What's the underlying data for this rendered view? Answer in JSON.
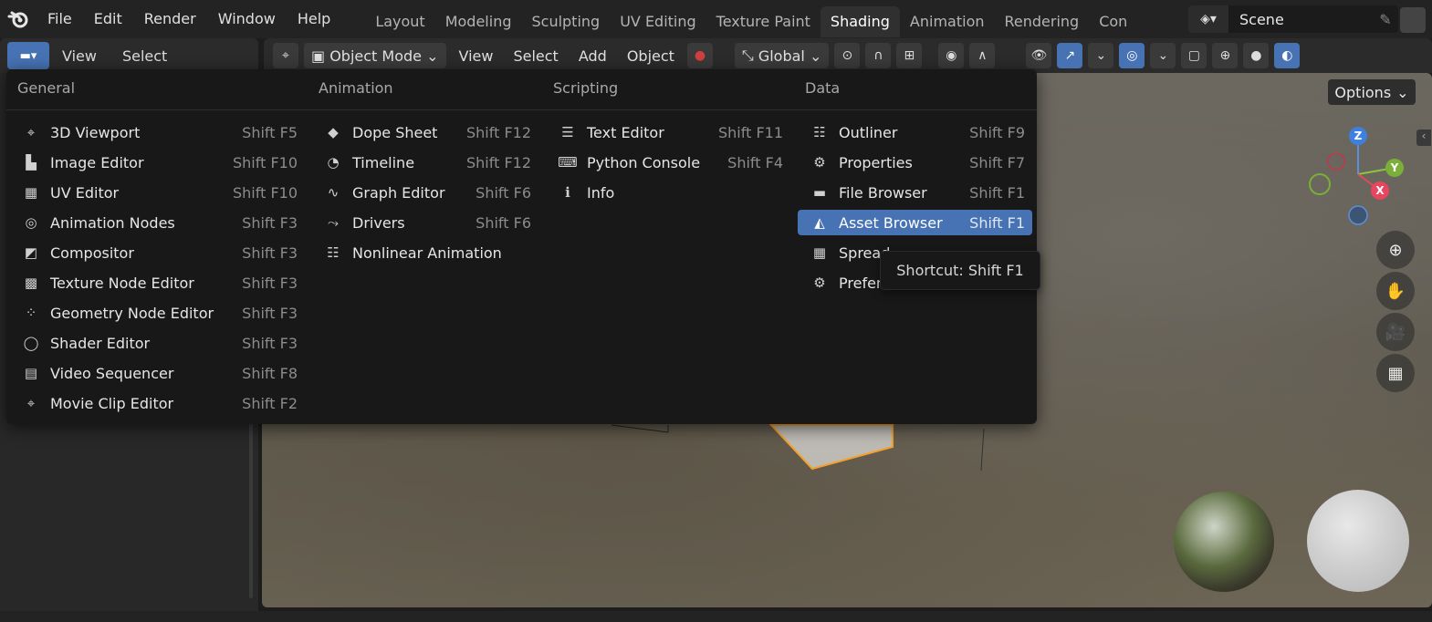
{
  "topbar": {
    "menus": [
      "File",
      "Edit",
      "Render",
      "Window",
      "Help"
    ],
    "workspaces": [
      "Layout",
      "Modeling",
      "Sculpting",
      "UV Editing",
      "Texture Paint",
      "Shading",
      "Animation",
      "Rendering",
      "Con"
    ],
    "active_workspace": "Shading",
    "scene_name": "Scene"
  },
  "left_header": {
    "items": [
      "View",
      "Select"
    ]
  },
  "viewport_header": {
    "mode": "Object Mode",
    "menus": [
      "View",
      "Select",
      "Add",
      "Object"
    ],
    "transform_orientation": "Global",
    "options_label": "Options"
  },
  "gizmo": {
    "z_label": "Z",
    "y_label": "Y",
    "x_label": "X"
  },
  "editor_menu": {
    "columns": [
      {
        "heading": "General",
        "items": [
          {
            "label": "3D Viewport",
            "shortcut": "Shift F5",
            "icon": "viewport-icon"
          },
          {
            "label": "Image Editor",
            "shortcut": "Shift F10",
            "icon": "image-icon"
          },
          {
            "label": "UV Editor",
            "shortcut": "Shift F10",
            "icon": "uv-icon"
          },
          {
            "label": "Animation Nodes",
            "shortcut": "Shift F3",
            "icon": "nodes-icon"
          },
          {
            "label": "Compositor",
            "shortcut": "Shift F3",
            "icon": "compositor-icon"
          },
          {
            "label": "Texture Node Editor",
            "shortcut": "Shift F3",
            "icon": "texture-icon"
          },
          {
            "label": "Geometry Node Editor",
            "shortcut": "Shift F3",
            "icon": "geometry-nodes-icon"
          },
          {
            "label": "Shader Editor",
            "shortcut": "Shift F3",
            "icon": "shader-icon"
          },
          {
            "label": "Video Sequencer",
            "shortcut": "Shift F8",
            "icon": "sequencer-icon"
          },
          {
            "label": "Movie Clip Editor",
            "shortcut": "Shift F2",
            "icon": "clip-icon"
          }
        ]
      },
      {
        "heading": "Animation",
        "items": [
          {
            "label": "Dope Sheet",
            "shortcut": "Shift F12",
            "icon": "dopesheet-icon"
          },
          {
            "label": "Timeline",
            "shortcut": "Shift F12",
            "icon": "timeline-icon"
          },
          {
            "label": "Graph Editor",
            "shortcut": "Shift F6",
            "icon": "graph-icon"
          },
          {
            "label": "Drivers",
            "shortcut": "Shift F6",
            "icon": "drivers-icon"
          },
          {
            "label": "Nonlinear Animation",
            "shortcut": "",
            "icon": "nla-icon"
          }
        ]
      },
      {
        "heading": "Scripting",
        "items": [
          {
            "label": "Text Editor",
            "shortcut": "Shift F11",
            "icon": "text-icon"
          },
          {
            "label": "Python Console",
            "shortcut": "Shift F4",
            "icon": "console-icon"
          },
          {
            "label": "Info",
            "shortcut": "",
            "icon": "info-icon"
          }
        ]
      },
      {
        "heading": "Data",
        "items": [
          {
            "label": "Outliner",
            "shortcut": "Shift F9",
            "icon": "outliner-icon"
          },
          {
            "label": "Properties",
            "shortcut": "Shift F7",
            "icon": "properties-icon"
          },
          {
            "label": "File Browser",
            "shortcut": "Shift F1",
            "icon": "folder-icon"
          },
          {
            "label": "Asset Browser",
            "shortcut": "Shift F1",
            "icon": "asset-icon",
            "active": true
          },
          {
            "label": "Spread",
            "shortcut": "",
            "icon": "spreadsheet-icon"
          },
          {
            "label": "Prefer",
            "shortcut": "",
            "icon": "gear-icon"
          }
        ]
      }
    ]
  },
  "tooltip": {
    "text": "Shortcut: Shift F1"
  },
  "colors": {
    "accent": "#4772b3",
    "menu_bg": "#181818",
    "active_cube_edge": "#f5a028"
  }
}
